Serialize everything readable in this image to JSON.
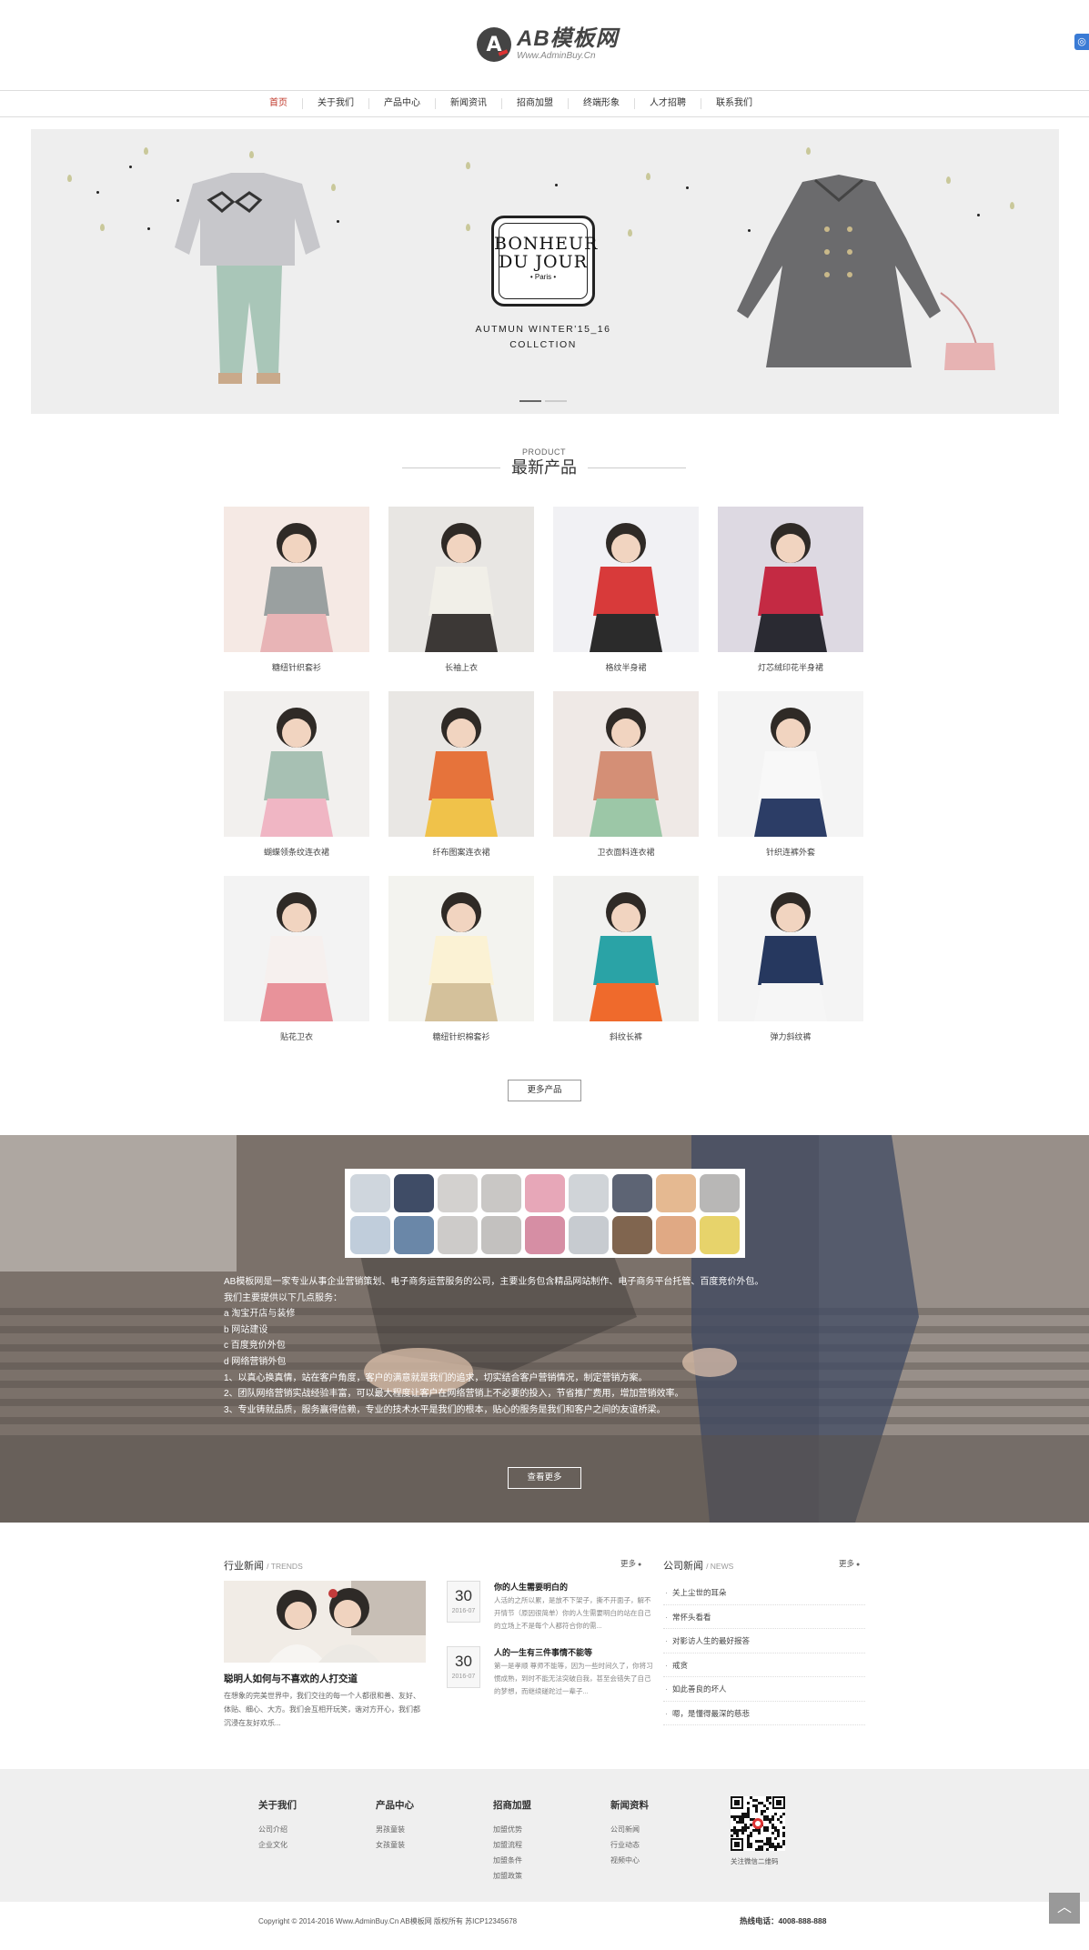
{
  "header": {
    "logo_title": "AB模板网",
    "logo_sub": "Www.AdminBuy.Cn"
  },
  "nav": {
    "items": [
      "首页",
      "关于我们",
      "产品中心",
      "新闻资讯",
      "招商加盟",
      "终端形象",
      "人才招聘",
      "联系我们"
    ],
    "active_index": 0
  },
  "banner": {
    "brand_line1": "BONHEUR",
    "brand_line2": "DU JOUR",
    "brand_line3": "• Paris •",
    "tagline1": "AUTMUN WINTER'15_16",
    "tagline2": "COLLCTION",
    "slides": 2,
    "active_slide": 0
  },
  "products_section": {
    "en": "PRODUCT",
    "cn": "最新产品",
    "items": [
      {
        "name": "糖纽针织套衫"
      },
      {
        "name": "长袖上衣"
      },
      {
        "name": "格纹半身裙"
      },
      {
        "name": "灯芯绒印花半身裙"
      },
      {
        "name": "蝴蝶领条纹连衣裙"
      },
      {
        "name": "纤布图案连衣裙"
      },
      {
        "name": "卫衣面料连衣裙"
      },
      {
        "name": "针织连裤外套"
      },
      {
        "name": "贴花卫衣"
      },
      {
        "name": "糖纽针织棉套衫"
      },
      {
        "name": "斜纹长裤"
      },
      {
        "name": "弹力斜纹裤"
      }
    ],
    "more_label": "更多产品"
  },
  "about": {
    "lines": [
      "AB模板网是一家专业从事企业营销策划、电子商务运营服务的公司，主要业务包含精品网站制作、电子商务平台托管、百度竞价外包。",
      "我们主要提供以下几点服务：",
      "a  淘宝开店与装修",
      "b  网站建设",
      "c  百度竞价外包",
      "d  网络营销外包",
      "1、以真心换真情，站在客户角度，客户的满意就是我们的追求，切实结合客户营销情况，制定营销方案。",
      "2、团队网络营销实战经验丰富，可以最大程度让客户在网络营销上不必要的投入，节省推广费用，增加营销效率。",
      "3、专业铸就品质，服务赢得信赖，专业的技术水平是我们的根本，贴心的服务是我们和客户之间的友谊桥梁。"
    ],
    "more_label": "查看更多"
  },
  "news": {
    "trends_title": "行业新闻",
    "trends_en": "/ TRENDS",
    "trends_more": "更多",
    "featured_title": "聪明人如何与不喜欢的人打交道",
    "featured_desc": "在想象的完美世界中，我们交往的每一个人都很和善、友好、体贴、细心、大方。我们会互相开玩笑，谐对方开心，我们都沉浸在友好欢乐...",
    "items": [
      {
        "day": "30",
        "month": "2016-07",
        "title": "你的人生需要明白的",
        "desc": "人活的之所以累，是放不下架子，撕不开面子，解不开情节（原因很简单）你的人生需要明白的站在自己的立场上不是每个人都符合你的需..."
      },
      {
        "day": "30",
        "month": "2016-07",
        "title": "人的一生有三件事情不能等",
        "desc": "第一是孝顺 尊师不能等，因为一些时间久了，你将习惯成熟，到时不能无法突破自我，甚至会错失了自己的梦想，而继续磋跎过一辈子..."
      }
    ],
    "company_title": "公司新闻",
    "company_en": "/ NEWS",
    "company_more": "更多",
    "company_items": [
      "关上尘世的耳朵",
      "常怀头看看",
      "对影访人生的最好报答",
      "戒贪",
      "如此善良的坏人",
      "嗯，是懂得最深的慈悲"
    ]
  },
  "footer": {
    "cols": [
      {
        "title": "关于我们",
        "links": [
          "公司介绍",
          "企业文化"
        ]
      },
      {
        "title": "产品中心",
        "links": [
          "男孩童装",
          "女孩童装"
        ]
      },
      {
        "title": "招商加盟",
        "links": [
          "加盟优势",
          "加盟流程",
          "加盟条件",
          "加盟政策"
        ]
      },
      {
        "title": "新闻资料",
        "links": [
          "公司新闻",
          "行业动态",
          "视频中心"
        ]
      }
    ],
    "qr_label": "关注微信二维码",
    "copyright": "Copyright © 2014-2016 Www.AdminBuy.Cn AB模板网 版权所有  苏ICP12345678",
    "hotline": "热线电话：4008-888-888"
  },
  "colors": {
    "accent": "#c0392b",
    "nav_border": "#dddddd",
    "banner_bg": "#eeeeee",
    "footer_bg": "#efefef"
  }
}
